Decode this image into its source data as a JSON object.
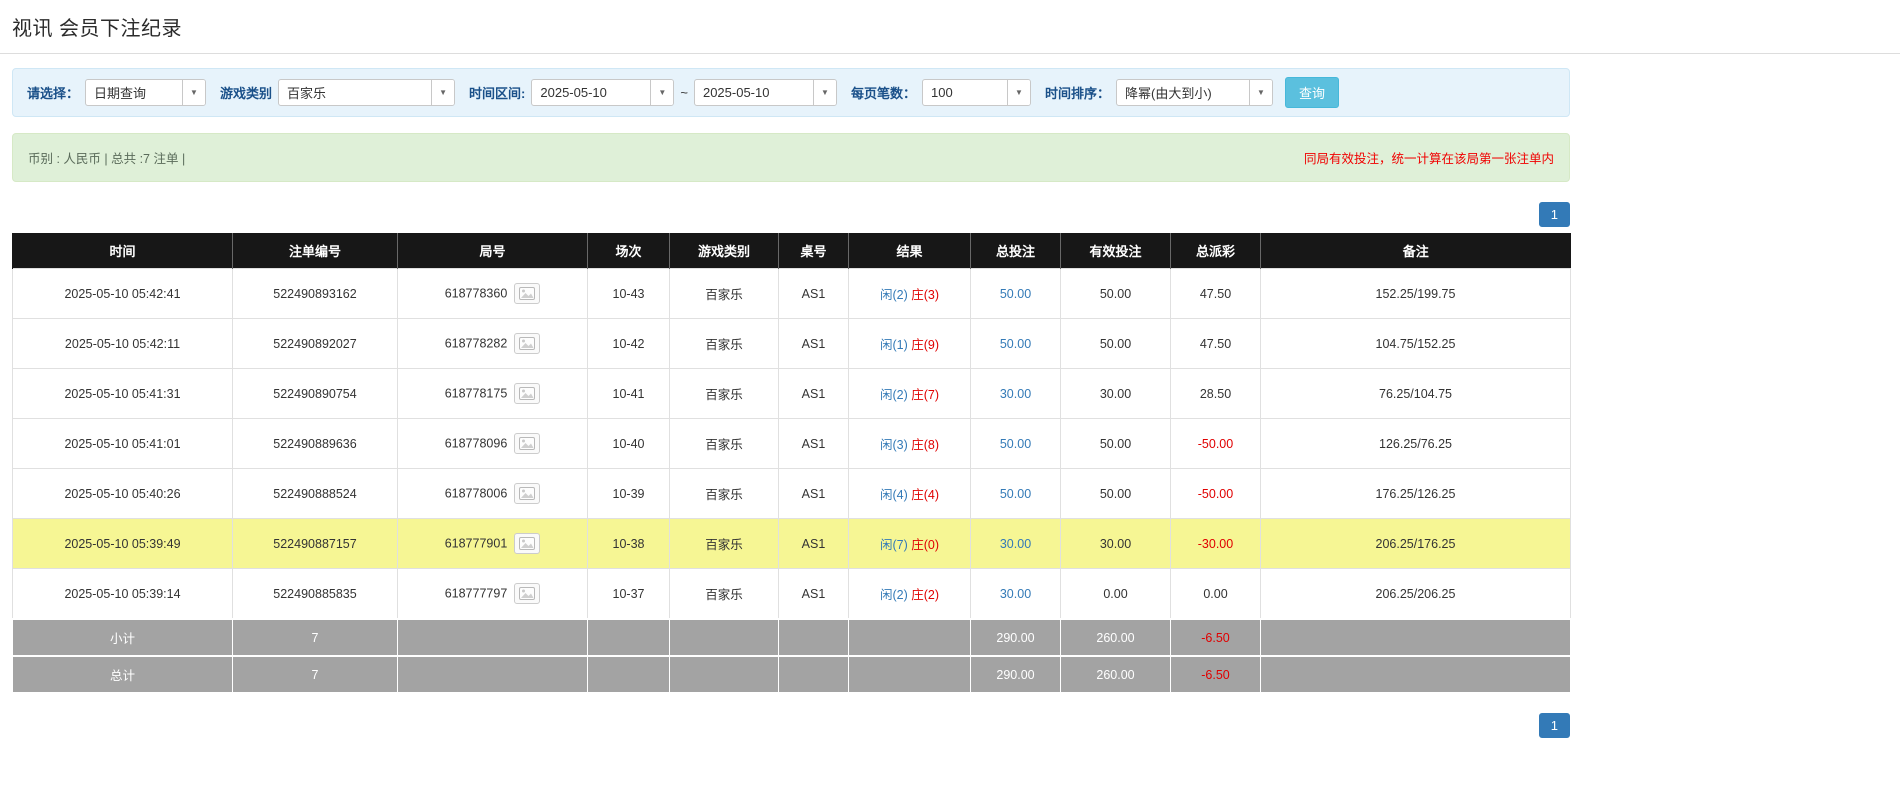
{
  "page": {
    "title": "视讯 会员下注纪录"
  },
  "filters": {
    "select_label": "请选择：",
    "select_value": "日期查询",
    "game_type_label": "游戏类别",
    "game_type_value": "百家乐",
    "date_range_label": "时间区间:",
    "date_from": "2025-05-10",
    "range_separator": "~",
    "date_to": "2025-05-10",
    "page_size_label": "每页笔数：",
    "page_size_value": "100",
    "sort_label": "时间排序：",
    "sort_value": "降幂(由大到小)",
    "search_button": "查询"
  },
  "summary": {
    "left": "币别 : 人民币 | 总共 :7 注单 |",
    "right": "同局有效投注，统一计算在该局第一张注单内"
  },
  "pagination": {
    "current_page": "1"
  },
  "colors": {
    "accent_blue": "#337ab7",
    "negative_red": "#e00000",
    "highlight_yellow": "#f6f694",
    "header_black": "#171717",
    "search_button_blue": "#5bc0de",
    "filter_bar_blue": "#e7f3fb",
    "summary_green": "#dff0d8"
  },
  "table": {
    "headers": [
      "时间",
      "注单编号",
      "局号",
      "场次",
      "游戏类别",
      "桌号",
      "结果",
      "总投注",
      "有效投注",
      "总派彩",
      "备注"
    ],
    "rows": [
      {
        "time": "2025-05-10 05:42:41",
        "bet_id": "522490893162",
        "round_no": "618778360",
        "session": "10-43",
        "game_type": "百家乐",
        "table_no": "AS1",
        "result_player": "闲(2)",
        "result_banker": "庄(3)",
        "total_bet": "50.00",
        "valid_bet": "50.00",
        "payout": "47.50",
        "note": "152.25/199.75",
        "highlight": false
      },
      {
        "time": "2025-05-10 05:42:11",
        "bet_id": "522490892027",
        "round_no": "618778282",
        "session": "10-42",
        "game_type": "百家乐",
        "table_no": "AS1",
        "result_player": "闲(1)",
        "result_banker": "庄(9)",
        "total_bet": "50.00",
        "valid_bet": "50.00",
        "payout": "47.50",
        "note": "104.75/152.25",
        "highlight": false
      },
      {
        "time": "2025-05-10 05:41:31",
        "bet_id": "522490890754",
        "round_no": "618778175",
        "session": "10-41",
        "game_type": "百家乐",
        "table_no": "AS1",
        "result_player": "闲(2)",
        "result_banker": "庄(7)",
        "total_bet": "30.00",
        "valid_bet": "30.00",
        "payout": "28.50",
        "note": "76.25/104.75",
        "highlight": false
      },
      {
        "time": "2025-05-10 05:41:01",
        "bet_id": "522490889636",
        "round_no": "618778096",
        "session": "10-40",
        "game_type": "百家乐",
        "table_no": "AS1",
        "result_player": "闲(3)",
        "result_banker": "庄(8)",
        "total_bet": "50.00",
        "valid_bet": "50.00",
        "payout": "-50.00",
        "note": "126.25/76.25",
        "highlight": false
      },
      {
        "time": "2025-05-10 05:40:26",
        "bet_id": "522490888524",
        "round_no": "618778006",
        "session": "10-39",
        "game_type": "百家乐",
        "table_no": "AS1",
        "result_player": "闲(4)",
        "result_banker": "庄(4)",
        "total_bet": "50.00",
        "valid_bet": "50.00",
        "payout": "-50.00",
        "note": "176.25/126.25",
        "highlight": false
      },
      {
        "time": "2025-05-10 05:39:49",
        "bet_id": "522490887157",
        "round_no": "618777901",
        "session": "10-38",
        "game_type": "百家乐",
        "table_no": "AS1",
        "result_player": "闲(7)",
        "result_banker": "庄(0)",
        "total_bet": "30.00",
        "valid_bet": "30.00",
        "payout": "-30.00",
        "note": "206.25/176.25",
        "highlight": true
      },
      {
        "time": "2025-05-10 05:39:14",
        "bet_id": "522490885835",
        "round_no": "618777797",
        "session": "10-37",
        "game_type": "百家乐",
        "table_no": "AS1",
        "result_player": "闲(2)",
        "result_banker": "庄(2)",
        "total_bet": "30.00",
        "valid_bet": "0.00",
        "payout": "0.00",
        "note": "206.25/206.25",
        "highlight": false
      }
    ],
    "footer_rows": [
      {
        "label": "小计",
        "count": "7",
        "total_bet": "290.00",
        "valid_bet": "260.00",
        "payout": "-6.50"
      },
      {
        "label": "总计",
        "count": "7",
        "total_bet": "290.00",
        "valid_bet": "260.00",
        "payout": "-6.50"
      }
    ]
  }
}
